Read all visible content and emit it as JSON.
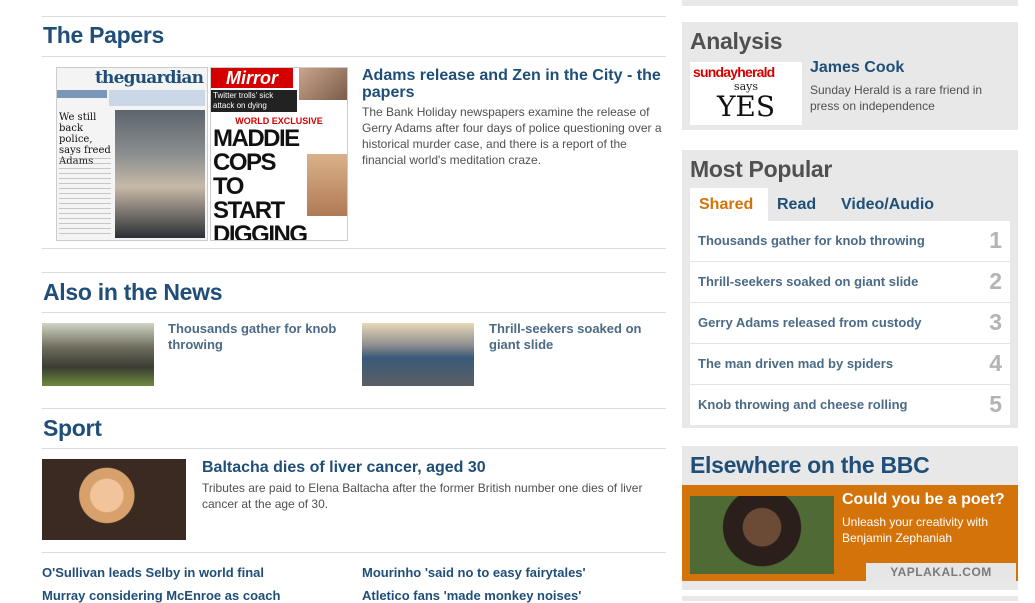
{
  "papers": {
    "title": "The Papers",
    "guardian": {
      "masthead": "theguardian",
      "headline": "We still back police, says freed Adams"
    },
    "mirror": {
      "masthead": "Mirror",
      "strap": "Twitter trolls' sick attack on dying Stephen",
      "exclusive": "WORLD EXCLUSIVE",
      "headline": "MADDIE COPS TO START DIGGING UP RESORT"
    },
    "lead_title": "Adams release and Zen in the City - the papers",
    "lead_text": "The Bank Holiday newspapers examine the release of Gerry Adams after four days of police questioning over a historical murder case, and there is a report of the financial world's meditation craze."
  },
  "also": {
    "title": "Also in the News",
    "items": [
      {
        "label": "Thousands gather for knob throwing"
      },
      {
        "label": "Thrill-seekers soaked on giant slide"
      }
    ]
  },
  "sport": {
    "title": "Sport",
    "lead_title": "Baltacha dies of liver cancer, aged 30",
    "lead_text": "Tributes are paid to Elena Baltacha after the former British number one dies of liver cancer at the age of 30.",
    "links": [
      "O'Sullivan leads Selby in world final",
      "Mourinho 'said no to easy fairytales'",
      "Murray considering McEnroe as coach",
      "Atletico fans 'made monkey noises'"
    ]
  },
  "analysis": {
    "title": "Analysis",
    "image": {
      "mast_a": "sunday",
      "mast_b": "herald",
      "says": "says",
      "yes": "YES"
    },
    "author": "James Cook",
    "text": "Sunday Herald is a rare friend in press on independence"
  },
  "popular": {
    "title": "Most Popular",
    "tabs": [
      "Shared",
      "Read",
      "Video/Audio"
    ],
    "items": [
      {
        "text": "Thousands gather for knob throwing",
        "num": "1"
      },
      {
        "text": "Thrill-seekers soaked on giant slide",
        "num": "2"
      },
      {
        "text": "Gerry Adams released from custody",
        "num": "3"
      },
      {
        "text": "The man driven mad by spiders",
        "num": "4"
      },
      {
        "text": "Knob throwing and cheese rolling",
        "num": "5"
      }
    ]
  },
  "elsewhere": {
    "title": "Elsewhere on the BBC",
    "promo_title": "Could you be a poet?",
    "promo_text": "Unleash your creativity with Benjamin Zephaniah",
    "watermark": "YAPLAKAL.COM"
  },
  "colors": {
    "heading_blue": "#1f4e79",
    "link_blue": "#4a6a85",
    "accent_orange": "#d4730a",
    "panel_gray": "#e8e8e8"
  }
}
